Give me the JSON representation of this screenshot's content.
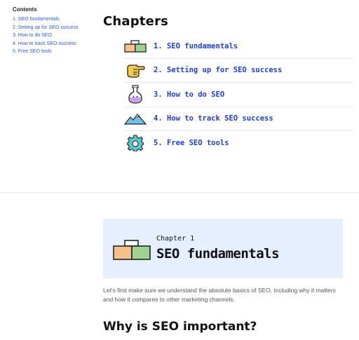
{
  "toc": {
    "title": "Contents",
    "items": [
      "1. SEO fundamentals",
      "2. Setting up for SEO success",
      "3. How to do SEO",
      "4. How to track SEO success",
      "5. Free SEO tools"
    ]
  },
  "chapters": {
    "title": "Chapters",
    "items": [
      {
        "label": "1. SEO fundamentals",
        "icon": "blocks-icon"
      },
      {
        "label": "2. Setting up for SEO success",
        "icon": "pointing-hand-icon"
      },
      {
        "label": "3. How to do SEO",
        "icon": "flask-icon"
      },
      {
        "label": "4. How to track SEO success",
        "icon": "mountain-icon"
      },
      {
        "label": "5. Free SEO tools",
        "icon": "gear-icon"
      }
    ]
  },
  "chapter_card": {
    "kicker": "Chapter 1",
    "title": "SEO fundamentals",
    "icon": "blocks-icon"
  },
  "intro_text": "Let's first make sure we understand the absolute basics of SEO, including why it matters and how it compares to other marketing channels.",
  "section_heading": "Why is SEO important?",
  "colors": {
    "link": "#2f5ae0",
    "chapter_link": "#1d3fd1",
    "card_bg": "#e6efff",
    "divider": "#ececec"
  }
}
